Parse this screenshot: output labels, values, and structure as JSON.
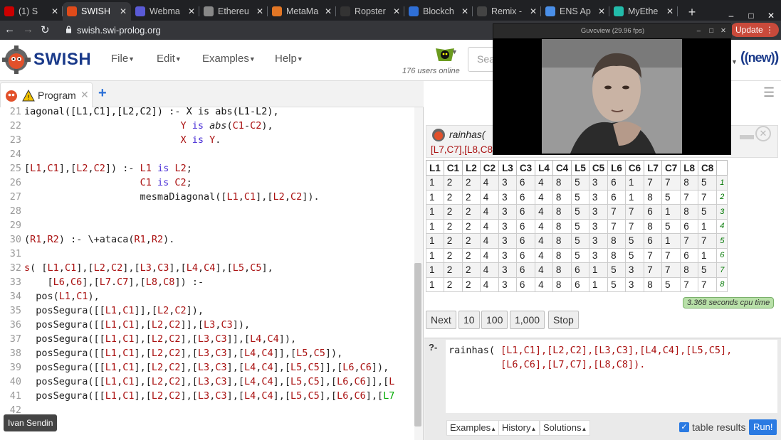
{
  "browser": {
    "tabs": [
      {
        "title": "(1) S",
        "color": "#c00",
        "icon": "youtube-icon",
        "active": false
      },
      {
        "title": "SWISH",
        "color": "#e04b1a",
        "icon": "swish-favicon",
        "active": true
      },
      {
        "title": "Webma",
        "color": "#5a5ad6",
        "icon": "webmail-icon",
        "active": false
      },
      {
        "title": "Ethereu",
        "color": "#888",
        "icon": "ethereum-icon",
        "active": false
      },
      {
        "title": "MetaMa",
        "color": "#e27625",
        "icon": "metamask-icon",
        "active": false
      },
      {
        "title": "Ropster",
        "color": "#333",
        "icon": "ropsten-icon",
        "active": false
      },
      {
        "title": "Blockch",
        "color": "#2f6fd6",
        "icon": "blockchain-icon",
        "active": false
      },
      {
        "title": "Remix -",
        "color": "#444",
        "icon": "remix-icon",
        "active": false
      },
      {
        "title": "ENS Ap",
        "color": "#4a8fe8",
        "icon": "ens-icon",
        "active": false
      },
      {
        "title": "MyEthe",
        "color": "#2ba",
        "icon": "myetherwallet-icon",
        "active": false
      }
    ],
    "new_tab": "+",
    "url": "swish.swi-prolog.org",
    "update_label": "Update"
  },
  "header": {
    "logo": "SWISH",
    "menus": [
      "File",
      "Edit",
      "Examples",
      "Help"
    ],
    "users_online": "176 users online",
    "search_placeholder": "Sea",
    "new_badge": "(new)"
  },
  "editor": {
    "tab_label": "Program",
    "lines": [
      {
        "n": "21",
        "html": "<span class=\"fn\">iagonal([L1,C1],[L2,C2]) :- X is abs(L1-L2),</span>"
      },
      {
        "n": "22",
        "html": "                           <span class=\"vr\">Y</span> <span class=\"kw\">is</span> <span class=\"it\">abs</span>(<span class=\"vr\">C1</span>-<span class=\"vr\">C2</span>),"
      },
      {
        "n": "23",
        "html": "                           <span class=\"vr\">X</span> <span class=\"kw\">is</span> <span class=\"vr\">Y</span>."
      },
      {
        "n": "24",
        "html": ""
      },
      {
        "n": "25",
        "html": "[<span class=\"vr\">L1</span>,<span class=\"vr\">C1</span>],[<span class=\"vr\">L2</span>,<span class=\"vr\">C2</span>]) :- <span class=\"vr\">L1</span> <span class=\"kw\">is</span> <span class=\"vr\">L2</span>;"
      },
      {
        "n": "26",
        "html": "                    <span class=\"vr\">C1</span> <span class=\"kw\">is</span> <span class=\"vr\">C2</span>;"
      },
      {
        "n": "27",
        "html": "                    mesmaDiagonal([<span class=\"vr\">L1</span>,<span class=\"vr\">C1</span>],[<span class=\"vr\">L2</span>,<span class=\"vr\">C2</span>])."
      },
      {
        "n": "28",
        "html": ""
      },
      {
        "n": "29",
        "html": ""
      },
      {
        "n": "30",
        "html": "(<span class=\"vr\">R1</span>,<span class=\"vr\">R2</span>) :- \\+ataca(<span class=\"vr\">R1</span>,<span class=\"vr\">R2</span>)."
      },
      {
        "n": "31",
        "html": ""
      },
      {
        "n": "32",
        "html": "<span class=\"vr\">s</span>( [<span class=\"vr\">L1</span>,<span class=\"vr\">C1</span>],[<span class=\"vr\">L2</span>,<span class=\"vr\">C2</span>],[<span class=\"vr\">L3</span>,<span class=\"vr\">C3</span>],[<span class=\"vr\">L4</span>,<span class=\"vr\">C4</span>],[<span class=\"vr\">L5</span>,<span class=\"vr\">C5</span>],"
      },
      {
        "n": "33",
        "html": "    [<span class=\"vr\">L6</span>,<span class=\"vr\">C6</span>],[<span class=\"vr\">L7</span>.<span class=\"vr\">C7</span>],[<span class=\"vr\">L8</span>,<span class=\"vr\">C8</span>]) :-"
      },
      {
        "n": "34",
        "html": "  pos(<span class=\"vr\">L1</span>,<span class=\"vr\">C1</span>),"
      },
      {
        "n": "35",
        "html": "  posSegura([[<span class=\"vr\">L1</span>,<span class=\"vr\">C1</span>]],[<span class=\"vr\">L2</span>,<span class=\"vr\">C2</span>]),"
      },
      {
        "n": "36",
        "html": "  posSegura([[<span class=\"vr\">L1</span>,<span class=\"vr\">C1</span>],[<span class=\"vr\">L2</span>,<span class=\"vr\">C2</span>]],[<span class=\"vr\">L3</span>,<span class=\"vr\">C3</span>]),"
      },
      {
        "n": "37",
        "html": "  posSegura([[<span class=\"vr\">L1</span>,<span class=\"vr\">C1</span>],[<span class=\"vr\">L2</span>,<span class=\"vr\">C2</span>],[<span class=\"vr\">L3</span>,<span class=\"vr\">C3</span>]],[<span class=\"vr\">L4</span>,<span class=\"vr\">C4</span>]),"
      },
      {
        "n": "38",
        "html": "  posSegura([[<span class=\"vr\">L1</span>,<span class=\"vr\">C1</span>],[<span class=\"vr\">L2</span>,<span class=\"vr\">C2</span>],[<span class=\"vr\">L3</span>,<span class=\"vr\">C3</span>],[<span class=\"vr\">L4</span>,<span class=\"vr\">C4</span>]],[<span class=\"vr\">L5</span>,<span class=\"vr\">C5</span>]),"
      },
      {
        "n": "39",
        "html": "  posSegura([[<span class=\"vr\">L1</span>,<span class=\"vr\">C1</span>],[<span class=\"vr\">L2</span>,<span class=\"vr\">C2</span>],[<span class=\"vr\">L3</span>,<span class=\"vr\">C3</span>],[<span class=\"vr\">L4</span>,<span class=\"vr\">C4</span>],[<span class=\"vr\">L5</span>,<span class=\"vr\">C5</span>]],[<span class=\"vr\">L6</span>,<span class=\"vr\">C6</span>]),"
      },
      {
        "n": "40",
        "html": "  posSegura([[<span class=\"vr\">L1</span>,<span class=\"vr\">C1</span>],[<span class=\"vr\">L2</span>,<span class=\"vr\">C2</span>],[<span class=\"vr\">L3</span>,<span class=\"vr\">C3</span>],[<span class=\"vr\">L4</span>,<span class=\"vr\">C4</span>],[<span class=\"vr\">L5</span>,<span class=\"vr\">C5</span>],[<span class=\"vr\">L6</span>,<span class=\"vr\">C6</span>]],[<span class=\"vr\">L</span>"
      },
      {
        "n": "41",
        "html": "  posSegura([[<span class=\"vr\">L1</span>,<span class=\"vr\">C1</span>],[<span class=\"vr\">L2</span>,<span class=\"vr\">C2</span>],[<span class=\"vr\">L3</span>,<span class=\"vr\">C3</span>],[<span class=\"vr\">L4</span>,<span class=\"vr\">C4</span>],[<span class=\"vr\">L5</span>,<span class=\"vr\">C5</span>],[<span class=\"vr\">L6</span>,<span class=\"vr\">C6</span>],[<span class=\"gr\">L7</span>"
      },
      {
        "n": "42",
        "html": ""
      }
    ],
    "user_label": "Ivan Sendin"
  },
  "results": {
    "query_header": "rainhas(",
    "query_header2": "[L7,C7],[L8,C8",
    "columns": [
      "L1",
      "C1",
      "L2",
      "C2",
      "L3",
      "C3",
      "L4",
      "C4",
      "L5",
      "C5",
      "L6",
      "C6",
      "L7",
      "C7",
      "L8",
      "C8"
    ],
    "rows": [
      [
        "1",
        "2",
        "2",
        "4",
        "3",
        "6",
        "4",
        "8",
        "5",
        "3",
        "6",
        "1",
        "7",
        "7",
        "8",
        "5"
      ],
      [
        "1",
        "2",
        "2",
        "4",
        "3",
        "6",
        "4",
        "8",
        "5",
        "3",
        "6",
        "1",
        "8",
        "5",
        "7",
        "7"
      ],
      [
        "1",
        "2",
        "2",
        "4",
        "3",
        "6",
        "4",
        "8",
        "5",
        "3",
        "7",
        "7",
        "6",
        "1",
        "8",
        "5"
      ],
      [
        "1",
        "2",
        "2",
        "4",
        "3",
        "6",
        "4",
        "8",
        "5",
        "3",
        "7",
        "7",
        "8",
        "5",
        "6",
        "1"
      ],
      [
        "1",
        "2",
        "2",
        "4",
        "3",
        "6",
        "4",
        "8",
        "5",
        "3",
        "8",
        "5",
        "6",
        "1",
        "7",
        "7"
      ],
      [
        "1",
        "2",
        "2",
        "4",
        "3",
        "6",
        "4",
        "8",
        "5",
        "3",
        "8",
        "5",
        "7",
        "7",
        "6",
        "1"
      ],
      [
        "1",
        "2",
        "2",
        "4",
        "3",
        "6",
        "4",
        "8",
        "6",
        "1",
        "5",
        "3",
        "7",
        "7",
        "8",
        "5"
      ],
      [
        "1",
        "2",
        "2",
        "4",
        "3",
        "6",
        "4",
        "8",
        "6",
        "1",
        "5",
        "3",
        "8",
        "5",
        "7",
        "7"
      ]
    ],
    "row_numbers": [
      "1",
      "2",
      "3",
      "4",
      "5",
      "6",
      "7",
      "8"
    ],
    "cpu_time": "3.368 seconds cpu time",
    "buttons": [
      "Next",
      "10",
      "100",
      "1,000",
      "Stop"
    ]
  },
  "query": {
    "prompt": "?-",
    "line1": "rainhas( [L1,C1],[L2,C2],[L3,C3],[L4,C4],[L5,C5],",
    "line2": "         [L6,C6],[L7,C7],[L8,C8]).",
    "footer_buttons": [
      "Examples",
      "History",
      "Solutions"
    ],
    "table_results_label": "table results",
    "run_label": "Run!"
  },
  "video": {
    "title": "Guvcview (29.96 fps)"
  }
}
